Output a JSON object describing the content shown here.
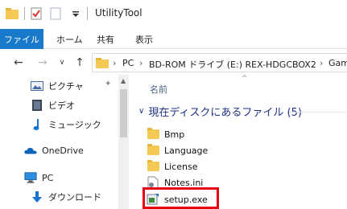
{
  "window": {
    "title": "UtilityTool"
  },
  "ribbon": {
    "tabs": [
      "ファイル",
      "ホーム",
      "共有",
      "表示"
    ]
  },
  "address": {
    "crumbs": [
      "PC",
      "BD-ROM ドライブ (E:) REX-HDGCBOX2",
      "Game"
    ],
    "separator": "›"
  },
  "nav": {
    "back": "←",
    "forward": "→",
    "dropdown": "∨",
    "up": "↑"
  },
  "sidebar": {
    "items": [
      {
        "label": "ピクチャ",
        "icon": "pictures-icon"
      },
      {
        "label": "ビデオ",
        "icon": "videos-icon"
      },
      {
        "label": "ミュージック",
        "icon": "music-icon"
      },
      {
        "label": "OneDrive",
        "icon": "onedrive-icon"
      },
      {
        "label": "PC",
        "icon": "pc-icon"
      },
      {
        "label": "ダウンロード",
        "icon": "download-icon"
      }
    ]
  },
  "content": {
    "column_name": "名前",
    "sort_caret": "^",
    "group": {
      "label": "現在ディスクにあるファイル (5)",
      "chevron": "∨"
    },
    "files": [
      {
        "name": "Bmp",
        "type": "folder"
      },
      {
        "name": "Language",
        "type": "folder"
      },
      {
        "name": "License",
        "type": "folder"
      },
      {
        "name": "Notes.ini",
        "type": "ini"
      },
      {
        "name": "setup.exe",
        "type": "exe"
      }
    ]
  },
  "colors": {
    "accent": "#1979ca",
    "highlight": "#e60012",
    "group_text": "#1e3287",
    "folder": "#f4c956"
  }
}
